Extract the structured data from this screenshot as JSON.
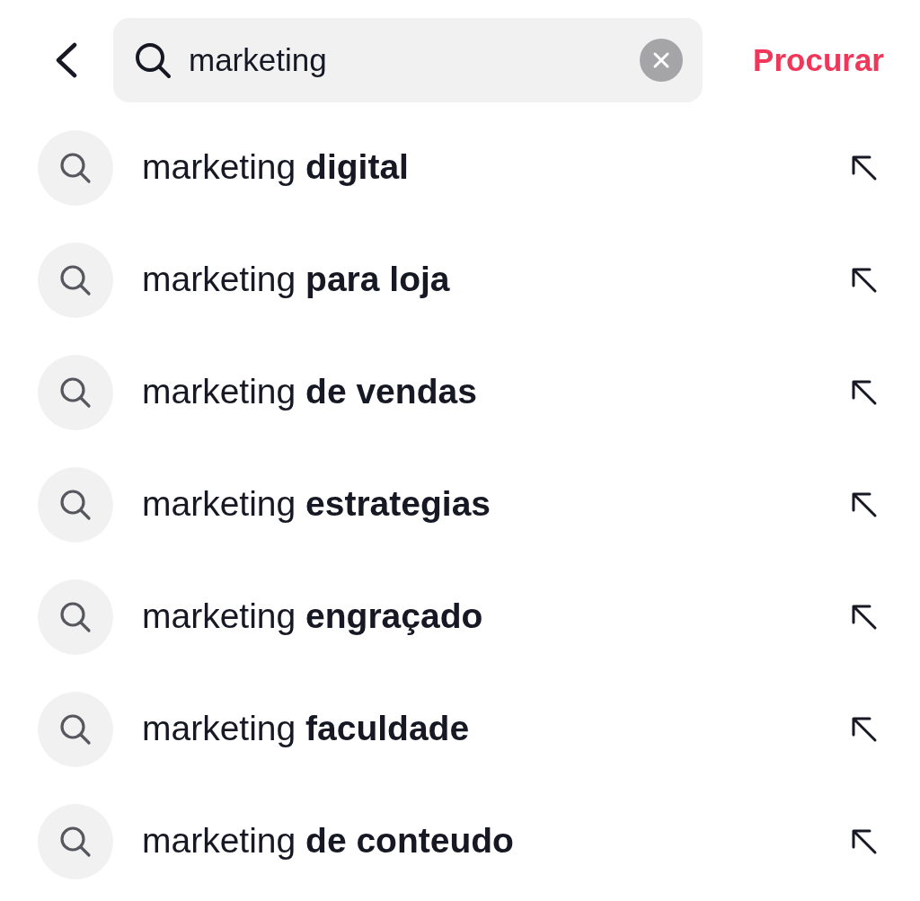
{
  "search": {
    "value": "marketing",
    "submit_label": "Procurar"
  },
  "suggestions": [
    {
      "text": "marketing **digital**"
    },
    {
      "text": "marketing **para loja**"
    },
    {
      "text": "marketing **de vendas**"
    },
    {
      "text": "marketing **estrategias**"
    },
    {
      "text": "marketing **engraçado**"
    },
    {
      "text": "marketing **faculdade**"
    },
    {
      "text": "marketing **de conteudo**"
    }
  ]
}
